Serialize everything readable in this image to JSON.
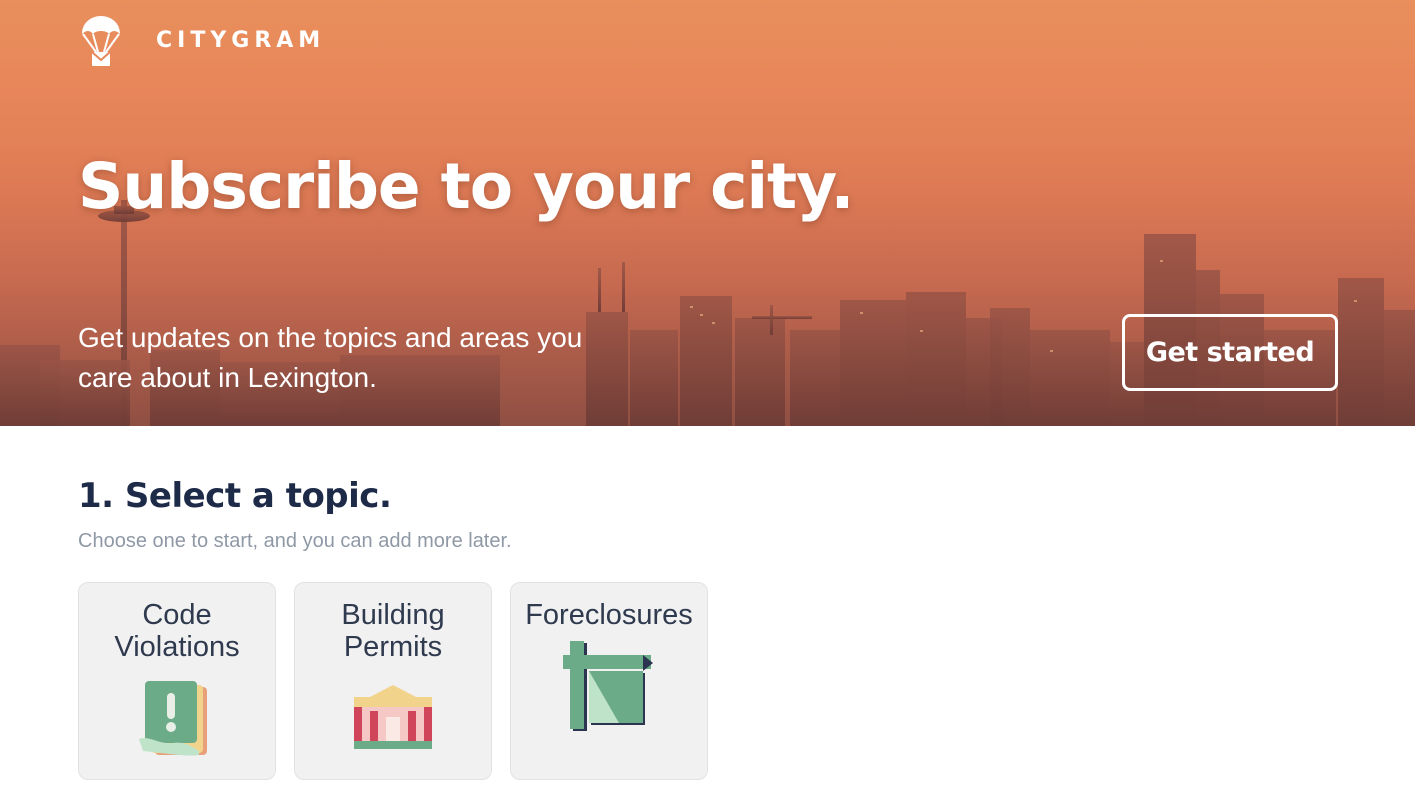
{
  "brand": {
    "name": "CITYGRAM",
    "logo_icon": "parachute-envelope-icon"
  },
  "hero": {
    "title": "Subscribe to your city.",
    "subtitle": "Get updates on the topics and areas you care about in Lexington.",
    "cta_label": "Get started"
  },
  "topic_section": {
    "title": "1. Select a topic.",
    "subtitle": "Choose one to start, and you can add more later.",
    "topics": [
      {
        "label": "Code Violations",
        "icon": "code-violation-book-icon"
      },
      {
        "label": "Building Permits",
        "icon": "building-permit-house-icon"
      },
      {
        "label": "Foreclosures",
        "icon": "foreclosure-sign-icon"
      }
    ]
  },
  "colors": {
    "hero_top": "#e88f5c",
    "hero_bottom": "#8f4f43",
    "heading": "#1d2a48",
    "muted": "#8f99a6",
    "card_bg": "#f1f1f1"
  }
}
